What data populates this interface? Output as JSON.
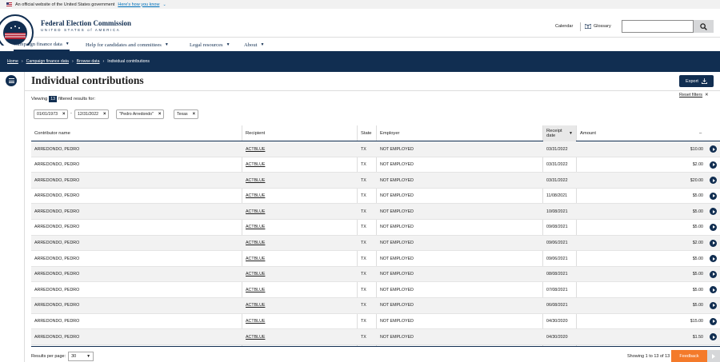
{
  "banner": {
    "text": "An official website of the United States government",
    "link": "Here's how you know"
  },
  "header": {
    "title": "Federal Election Commission",
    "subtitle": "UNITED STATES of AMERICA",
    "calendar": "Calendar",
    "glossary": "Glossary",
    "search_placeholder": ""
  },
  "nav": [
    {
      "label": "Campaign finance data"
    },
    {
      "label": "Help for candidates and committees"
    },
    {
      "label": "Legal resources"
    },
    {
      "label": "About"
    }
  ],
  "breadcrumb": {
    "home": "Home",
    "sep1": "›",
    "cf": "Campaign finance data",
    "sep2": "›",
    "browse": "Browse data",
    "sep3": "›",
    "current": "Individual contributions"
  },
  "page": {
    "title": "Individual contributions",
    "export": "Export",
    "reset_filters": "Reset filters",
    "viewing_prefix": "Viewing",
    "count": "13",
    "viewing_suffix": "filtered results for:"
  },
  "filters": {
    "date_from": "01/01/1973",
    "date_to": "12/31/2022",
    "name": "\"Pedro Arredondo\"",
    "state": "Texas",
    "dash": "-"
  },
  "table": {
    "headers": {
      "contributor": "Contributor name",
      "recipient": "Recipient",
      "state": "State",
      "employer": "Employer",
      "receipt_date": "Receipt date",
      "amount": "Amount",
      "extra": "–"
    },
    "rows": [
      {
        "name": "ARREDONDO, PEDRO",
        "recipient": "ACTBLUE",
        "state": "TX",
        "employer": "NOT EMPLOYED",
        "date": "03/31/2022",
        "amount": "$10.00"
      },
      {
        "name": "ARREDONDO, PEDRO",
        "recipient": "ACTBLUE",
        "state": "TX",
        "employer": "NOT EMPLOYED",
        "date": "03/31/2022",
        "amount": "$2.00"
      },
      {
        "name": "ARREDONDO, PEDRO",
        "recipient": "ACTBLUE",
        "state": "TX",
        "employer": "NOT EMPLOYED",
        "date": "03/31/2022",
        "amount": "$20.00"
      },
      {
        "name": "ARREDONDO, PEDRO",
        "recipient": "ACTBLUE",
        "state": "TX",
        "employer": "NOT EMPLOYED",
        "date": "11/08/2021",
        "amount": "$5.00"
      },
      {
        "name": "ARREDONDO, PEDRO",
        "recipient": "ACTBLUE",
        "state": "TX",
        "employer": "NOT EMPLOYED",
        "date": "10/08/2021",
        "amount": "$5.00"
      },
      {
        "name": "ARREDONDO, PEDRO",
        "recipient": "ACTBLUE",
        "state": "TX",
        "employer": "NOT EMPLOYED",
        "date": "09/08/2021",
        "amount": "$5.00"
      },
      {
        "name": "ARREDONDO, PEDRO",
        "recipient": "ACTBLUE",
        "state": "TX",
        "employer": "NOT EMPLOYED",
        "date": "09/06/2021",
        "amount": "$2.00"
      },
      {
        "name": "ARREDONDO, PEDRO",
        "recipient": "ACTBLUE",
        "state": "TX",
        "employer": "NOT EMPLOYED",
        "date": "09/06/2021",
        "amount": "$5.00"
      },
      {
        "name": "ARREDONDO, PEDRO",
        "recipient": "ACTBLUE",
        "state": "TX",
        "employer": "NOT EMPLOYED",
        "date": "08/08/2021",
        "amount": "$5.00"
      },
      {
        "name": "ARREDONDO, PEDRO",
        "recipient": "ACTBLUE",
        "state": "TX",
        "employer": "NOT EMPLOYED",
        "date": "07/08/2021",
        "amount": "$5.00"
      },
      {
        "name": "ARREDONDO, PEDRO",
        "recipient": "ACTBLUE",
        "state": "TX",
        "employer": "NOT EMPLOYED",
        "date": "06/08/2021",
        "amount": "$5.00"
      },
      {
        "name": "ARREDONDO, PEDRO",
        "recipient": "ACTBLUE",
        "state": "TX",
        "employer": "NOT EMPLOYED",
        "date": "04/30/2020",
        "amount": "$15.00"
      },
      {
        "name": "ARREDONDO, PEDRO",
        "recipient": "ACTBLUE",
        "state": "TX",
        "employer": "NOT EMPLOYED",
        "date": "04/30/2020",
        "amount": "$1.50"
      }
    ]
  },
  "footer": {
    "per_page_label": "Results per page:",
    "per_page_value": "30",
    "showing": "Showing 1 to 13 of 13",
    "feedback": "Feedback"
  }
}
